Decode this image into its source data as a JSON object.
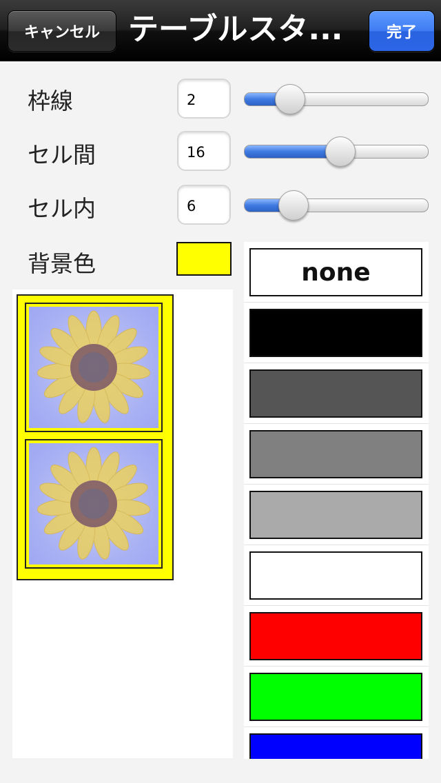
{
  "nav": {
    "cancel_label": "キャンセル",
    "title": "テーブルスタ...",
    "done_label": "完了"
  },
  "settings": [
    {
      "label": "枠線",
      "value": "2",
      "slider_fraction": 0.2
    },
    {
      "label": "セル間",
      "value": "16",
      "slider_fraction": 0.52
    },
    {
      "label": "セル内",
      "value": "6",
      "slider_fraction": 0.22
    }
  ],
  "background": {
    "label": "背景色",
    "color": "#ffff00"
  },
  "color_options": [
    {
      "label": "none",
      "color": "#ffffff"
    },
    {
      "label": "",
      "color": "#000000"
    },
    {
      "label": "",
      "color": "#555555"
    },
    {
      "label": "",
      "color": "#808080"
    },
    {
      "label": "",
      "color": "#aaaaaa"
    },
    {
      "label": "",
      "color": "#ffffff"
    },
    {
      "label": "",
      "color": "#ff0000"
    },
    {
      "label": "",
      "color": "#00ff00"
    },
    {
      "label": "",
      "color": "#0000ff"
    }
  ],
  "preview": {
    "cell_count": 2,
    "image_icon": "sunflower-photo"
  }
}
